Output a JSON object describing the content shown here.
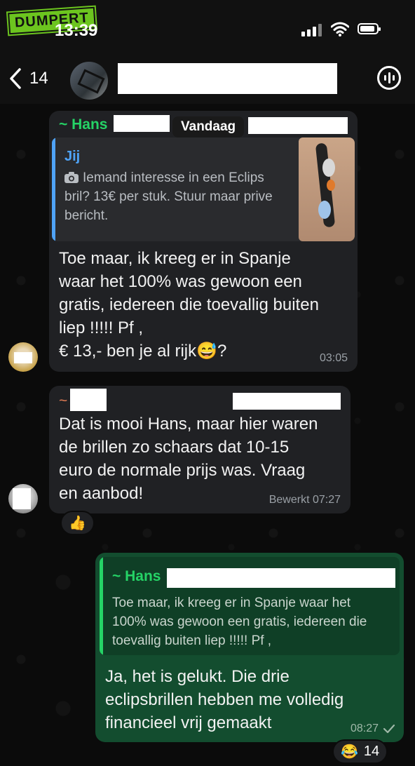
{
  "status_bar": {
    "time": "13:39",
    "watermark": "DUMPERT"
  },
  "header": {
    "back_count": "14"
  },
  "date_separator": "Vandaag",
  "messages": [
    {
      "sender": "~ Hans",
      "quote": {
        "author": "Jij",
        "text": "Iemand interesse in een Eclips bril? 13€ per stuk. Stuur maar prive bericht.",
        "media_icon": "camera-icon"
      },
      "lines": [
        "Toe maar, ik kreeg er in Spanje",
        "waar het 100% was gewoon een",
        "gratis, iedereen die toevallig buiten",
        "liep !!!!! Pf ,",
        "€ 13,-  ben  je al rijk😅?"
      ],
      "time": "03:05"
    },
    {
      "sender": "~",
      "lines": [
        "Dat is mooi Hans, maar hier waren",
        "de brillen zo schaars dat 10-15",
        "euro de normale prijs was. Vraag",
        "en aanbod!"
      ],
      "time": "Bewerkt 07:27",
      "reaction": "👍"
    },
    {
      "quote": {
        "author": "~ Hans",
        "lines": [
          "Toe maar, ik kreeg er in Spanje waar het",
          "100% was gewoon een gratis, iedereen die",
          "toevallig buiten liep !!!!! Pf ,"
        ]
      },
      "lines": [
        "Ja, het is gelukt. Die drie",
        "eclipsbrillen hebben me volledig",
        "financieel vrij gemaakt"
      ],
      "time": "08:27",
      "status": "read",
      "reaction": {
        "emoji": "😂",
        "count": "14"
      }
    }
  ],
  "colors": {
    "sender": "#25d366",
    "quote_author": "#4fa3f7",
    "outgoing": "#134d2f",
    "incoming": "#202124"
  }
}
